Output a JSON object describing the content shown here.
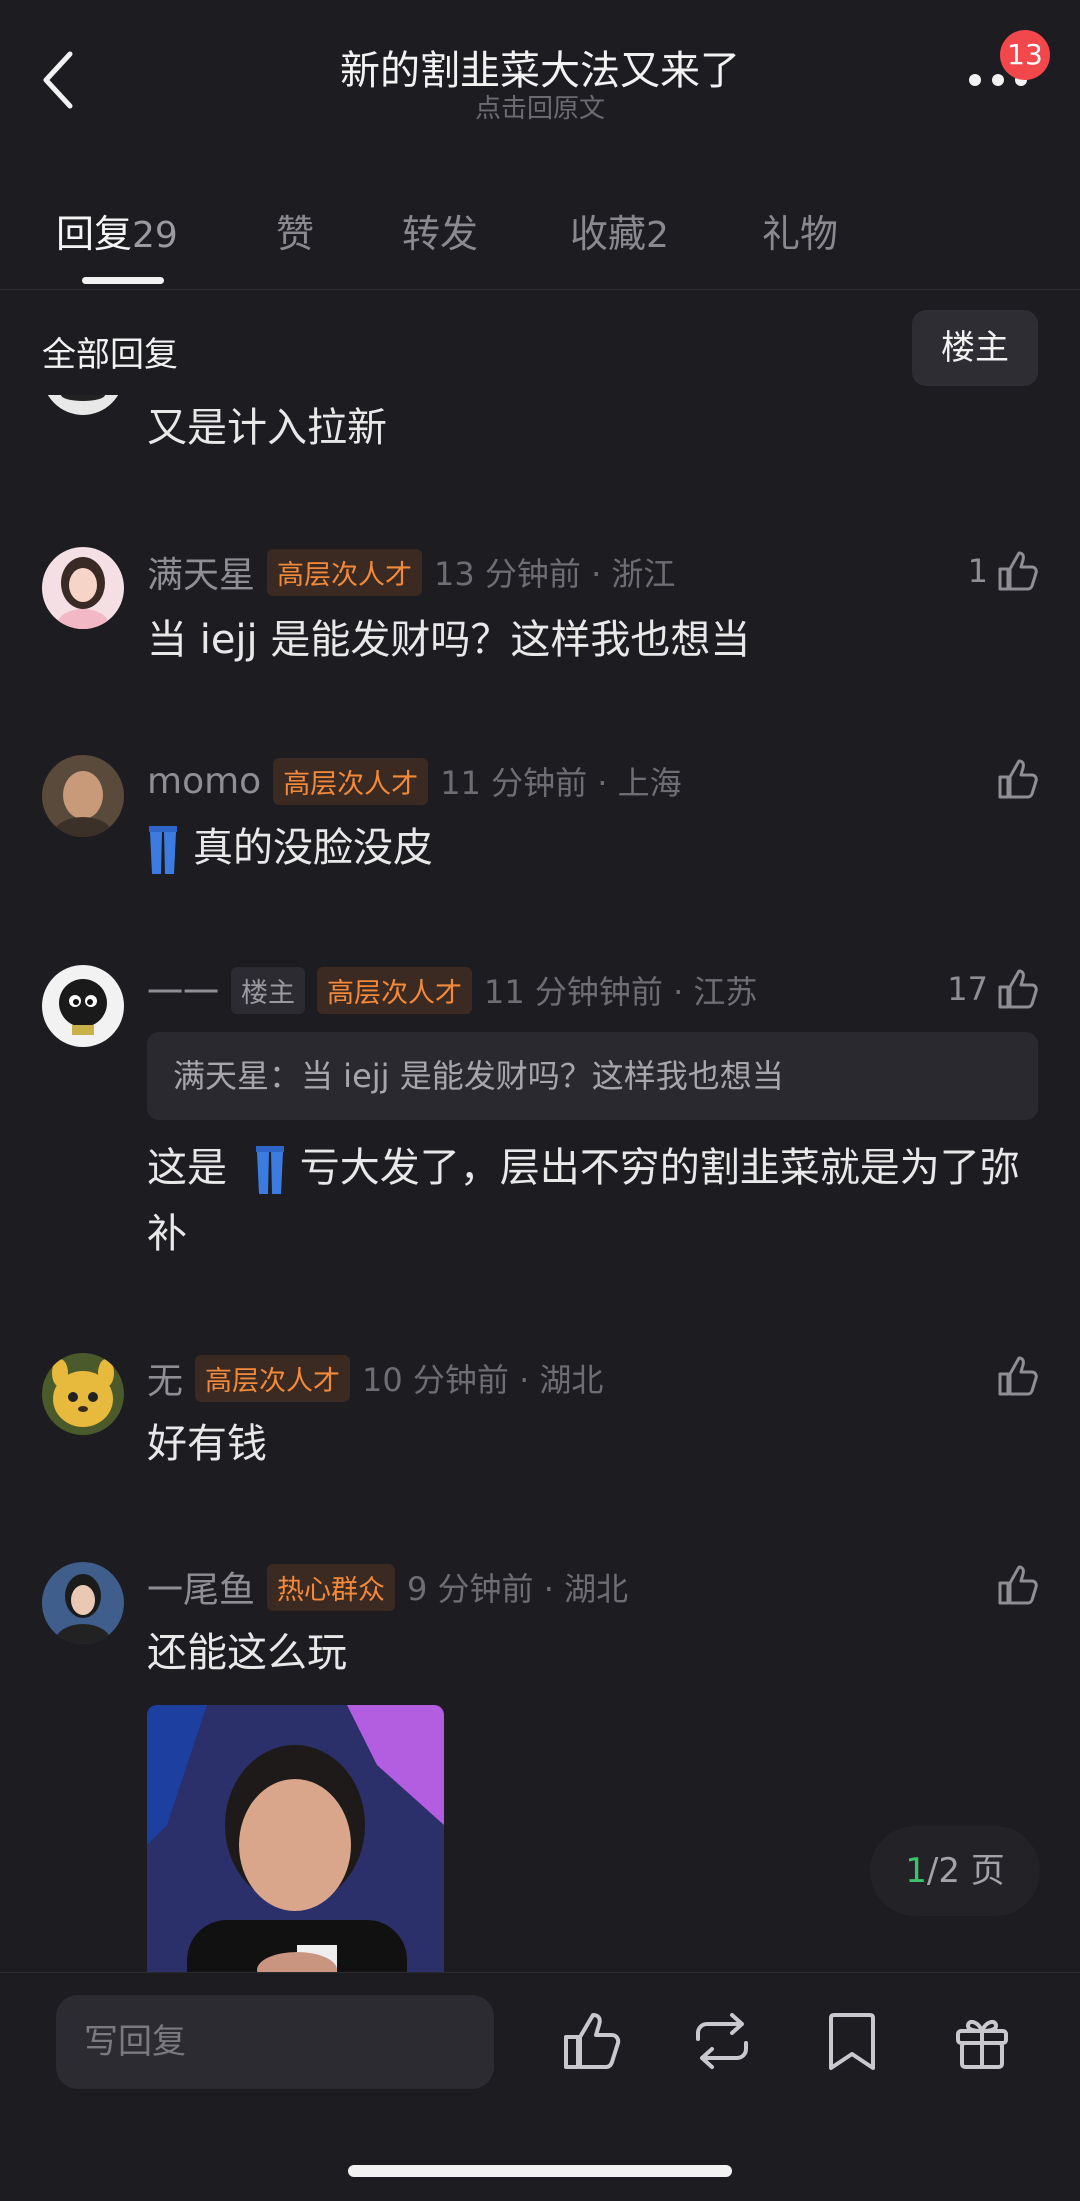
{
  "header": {
    "title": "新的割韭菜大法又来了",
    "subtitle": "点击回原文",
    "notification_count": "13"
  },
  "tabs": [
    {
      "label": "回复",
      "count": "29",
      "active": true
    },
    {
      "label": "赞",
      "count": ""
    },
    {
      "label": "转发",
      "count": ""
    },
    {
      "label": "收藏",
      "count": "2"
    },
    {
      "label": "礼物",
      "count": ""
    }
  ],
  "filter": {
    "label": "全部回复",
    "owner_button": "楼主"
  },
  "comments": [
    {
      "text": "又是计入拉新"
    },
    {
      "user": "满天星",
      "tag": "高层次人才",
      "meta": "13 分钟前 · 浙江",
      "likes": "1",
      "text": "当 iejj 是能发财吗？这样我也想当"
    },
    {
      "user": "momo",
      "tag": "高层次人才",
      "meta": "11 分钟前 · 上海",
      "likes": "",
      "emoji": "jeans-emoji",
      "text": "真的没脸没皮"
    },
    {
      "user": "一一",
      "owner_tag": "楼主",
      "tag": "高层次人才",
      "meta": "11 分钟钟前 · 江苏",
      "likes": "17",
      "quote": "满天星：当 iejj 是能发财吗？这样我也想当",
      "text_before": "这是",
      "emoji": "jeans-emoji",
      "text_after": "亏大发了，层出不穷的割韭菜就是为了弥补"
    },
    {
      "user": "无",
      "tag": "高层次人才",
      "meta": "10 分钟前 · 湖北",
      "likes": "",
      "text": "好有钱"
    },
    {
      "user": "一尾鱼",
      "tag": "热心群众",
      "meta": "9 分钟前 · 湖北",
      "likes": "",
      "text": "还能这么玩"
    }
  ],
  "pager": {
    "current": "1",
    "total_text": "/2 页"
  },
  "bottom": {
    "reply_placeholder": "写回复"
  },
  "colors": {
    "accent_orange": "#f3893a",
    "badge_red": "#f2474b",
    "pager_green": "#3bc46a",
    "background": "#1d1c21"
  }
}
